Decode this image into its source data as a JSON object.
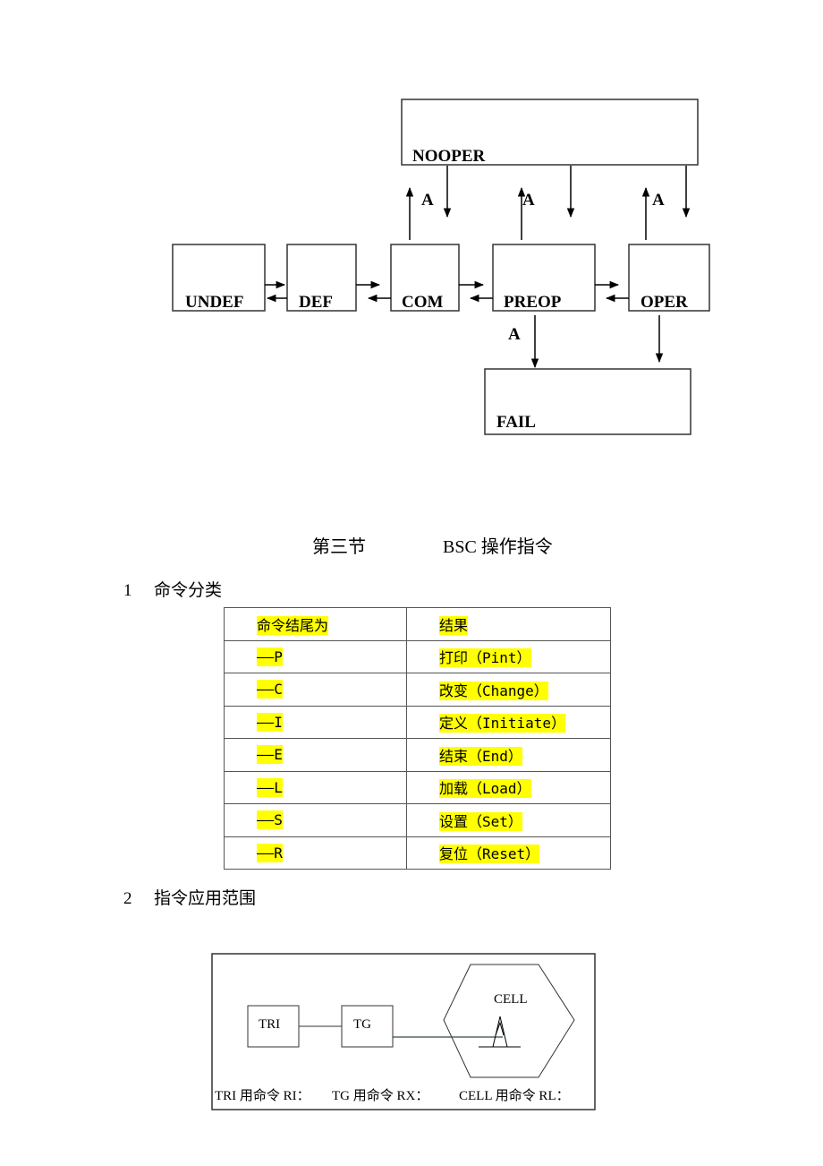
{
  "state_diagram": {
    "states": [
      "UNDEF",
      "DEF",
      "COM",
      "PREOP",
      "OPER"
    ],
    "nooper_label": "NOOPER",
    "fail_label": "FAIL",
    "arrow_label": "A"
  },
  "section": {
    "chapter": "第三节",
    "title": "BSC 操作指令"
  },
  "subsection1": {
    "number": "1",
    "title": "命令分类"
  },
  "command_table": {
    "header": [
      "命令结尾为",
      "结果"
    ],
    "rows": [
      [
        "——P",
        "打印（Pint）"
      ],
      [
        "——C",
        "改变（Change）"
      ],
      [
        "——I",
        "定义（Initiate）"
      ],
      [
        "——E",
        "结束（End）"
      ],
      [
        "——L",
        "加载（Load）"
      ],
      [
        "——S",
        "设置（Set）"
      ],
      [
        "——R",
        "复位（Reset）"
      ]
    ],
    "highlight_color": "#ffff00"
  },
  "subsection2": {
    "number": "2",
    "title": "指令应用范围"
  },
  "scope_diagram": {
    "tri_label": "TRI",
    "tg_label": "TG",
    "cell_label": "CELL",
    "captions": [
      "TRI 用命令 RI：",
      "TG 用命令 RX：",
      "CELL 用命令 RL："
    ]
  }
}
